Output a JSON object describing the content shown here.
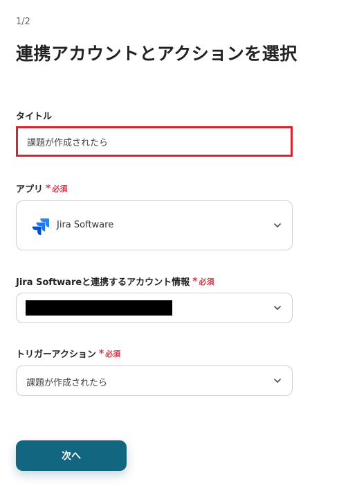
{
  "header": {
    "step": "1/2",
    "title": "連携アカウントとアクションを選択"
  },
  "fields": {
    "title": {
      "label": "タイトル",
      "value": "課題が作成されたら"
    },
    "app": {
      "label": "アプリ",
      "required_mark": "*",
      "required_text": "必須",
      "value": "Jira Software",
      "icon": "jira-software-logo"
    },
    "account": {
      "label": "Jira Softwareと連携するアカウント情報",
      "required_mark": "*",
      "required_text": "必須",
      "value_redacted": true
    },
    "trigger": {
      "label": "トリガーアクション",
      "required_mark": "*",
      "required_text": "必須",
      "value": "課題が作成されたら"
    }
  },
  "actions": {
    "next_label": "次へ"
  },
  "colors": {
    "accent": "#12667f",
    "required": "#e0334a",
    "highlight_border": "#e0202a",
    "jira_blue": "#2684ff"
  }
}
